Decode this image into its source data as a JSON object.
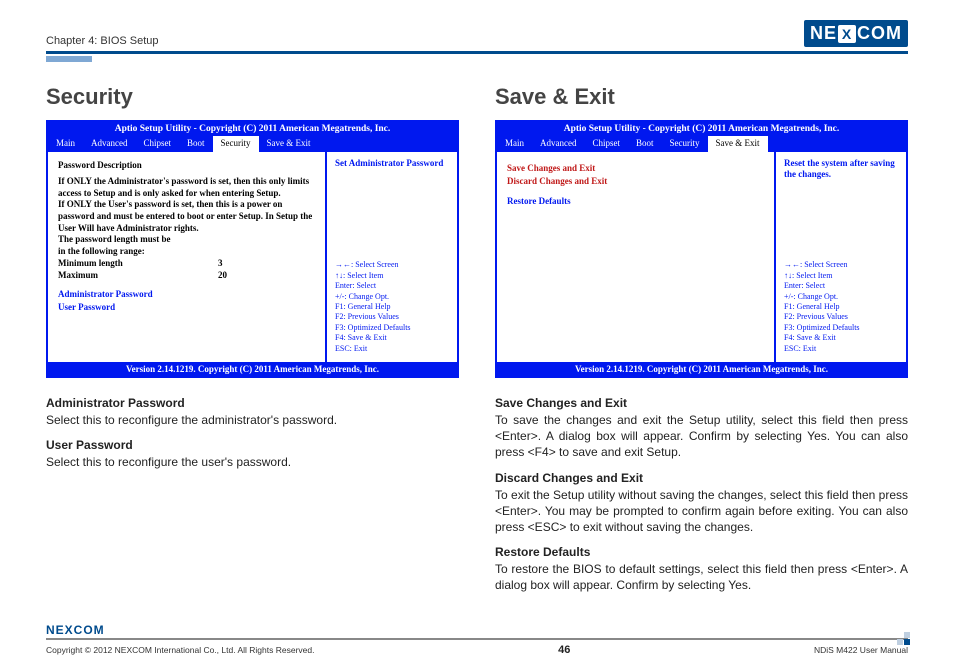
{
  "header": {
    "chapter": "Chapter 4: BIOS Setup",
    "logo_left": "NE",
    "logo_x": "X",
    "logo_right": "COM"
  },
  "left": {
    "title": "Security",
    "bios": {
      "title": "Aptio Setup Utility - Copyright (C) 2011 American Megatrends, Inc.",
      "tabs": [
        "Main",
        "Advanced",
        "Chipset",
        "Boot",
        "Security",
        "Save & Exit"
      ],
      "active_tab": "Security",
      "help": "Set Administrator Password",
      "desc_heading": "Password Description",
      "desc_body": "If ONLY the Administrator's password is set, then this only limits access to Setup and is only asked for when entering Setup.\nIf ONLY the User's password is set, then this is a power on password and must be entered to boot or enter Setup. In Setup the User Will have Administrator rights.\nThe password length must be\nin the following range:",
      "min_label": "Minimum length",
      "min_value": "3",
      "max_label": "Maximum",
      "max_value": "20",
      "item1": "Administrator Password",
      "item2": "User Password",
      "keys": [
        "→←: Select Screen",
        "↑↓: Select Item",
        "Enter: Select",
        "+/-: Change Opt.",
        "F1: General Help",
        "F2: Previous Values",
        "F3: Optimized Defaults",
        "F4: Save & Exit",
        "ESC: Exit"
      ],
      "footer": "Version 2.14.1219. Copyright (C) 2011 American Megatrends, Inc."
    },
    "desc": [
      {
        "h": "Administrator Password",
        "p": "Select this to reconfigure the administrator's password."
      },
      {
        "h": "User Password",
        "p": "Select this to reconfigure the user's password."
      }
    ]
  },
  "right": {
    "title": "Save & Exit",
    "bios": {
      "title": "Aptio Setup Utility - Copyright (C) 2011 American Megatrends, Inc.",
      "tabs": [
        "Main",
        "Advanced",
        "Chipset",
        "Boot",
        "Security",
        "Save & Exit"
      ],
      "active_tab": "Save & Exit",
      "help": "Reset the system after saving the changes.",
      "item1": "Save Changes and Exit",
      "item2": "Discard Changes and Exit",
      "item3": "Restore Defaults",
      "keys": [
        "→←: Select Screen",
        "↑↓: Select Item",
        "Enter: Select",
        "+/-: Change Opt.",
        "F1: General Help",
        "F2: Previous Values",
        "F3: Optimized Defaults",
        "F4: Save & Exit",
        "ESC: Exit"
      ],
      "footer": "Version 2.14.1219. Copyright (C) 2011 American Megatrends, Inc."
    },
    "desc": [
      {
        "h": "Save Changes and Exit",
        "p": "To save the changes and exit the Setup utility, select this field then press <Enter>. A dialog box will appear. Confirm by selecting Yes. You can also press <F4> to save and exit Setup."
      },
      {
        "h": "Discard Changes and Exit",
        "p": "To exit the Setup utility without saving the changes, select this field then press <Enter>. You may be prompted to confirm again before exiting. You can also press <ESC> to exit without saving the changes."
      },
      {
        "h": "Restore Defaults",
        "p": "To restore the BIOS to default settings, select this field then press <Enter>. A dialog box will appear. Confirm by selecting Yes."
      }
    ]
  },
  "footer": {
    "logo": "NEXCOM",
    "copyright": "Copyright © 2012 NEXCOM International Co., Ltd. All Rights Reserved.",
    "page": "46",
    "manual": "NDiS M422 User Manual"
  }
}
